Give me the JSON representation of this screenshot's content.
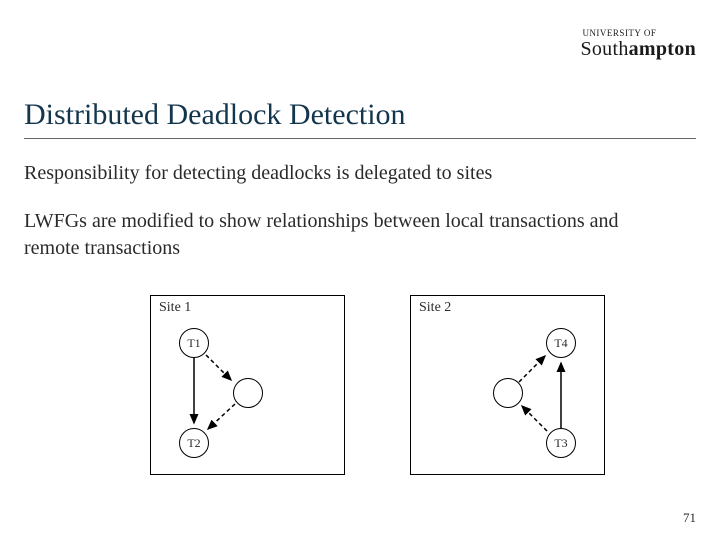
{
  "logo": {
    "small": "UNIVERSITY OF",
    "main_prefix": "South",
    "main_bold": "ampton"
  },
  "title": "Distributed Deadlock Detection",
  "paragraph1": "Responsibility for detecting deadlocks is delegated to sites",
  "paragraph2": "LWFGs are modified to show relationships between local transactions and remote transactions",
  "site1": {
    "label": "Site 1",
    "node_top": "T1",
    "node_bottom": "T2"
  },
  "site2": {
    "label": "Site 2",
    "node_top": "T4",
    "node_bottom": "T3"
  },
  "page_number": "71"
}
